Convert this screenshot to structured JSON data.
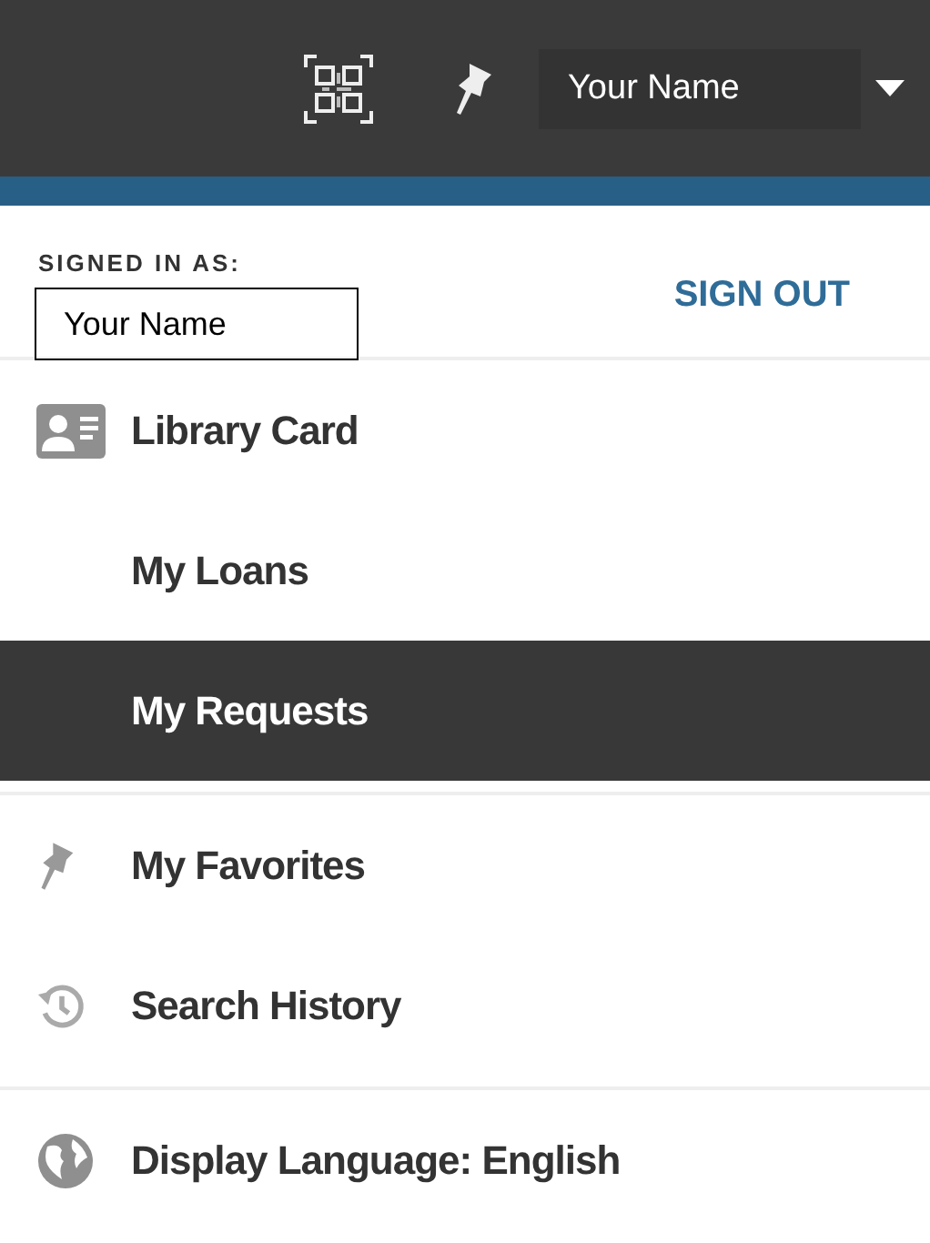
{
  "header": {
    "user_name": "Your Name"
  },
  "account": {
    "label": "SIGNED IN AS:",
    "name": "Your Name",
    "sign_out": "SIGN OUT"
  },
  "menu_groups": [
    {
      "items": [
        {
          "label": "Library Card",
          "kind": "card",
          "selected": false
        },
        {
          "label": "My Loans",
          "kind": "plain",
          "selected": false
        },
        {
          "label": "My Requests",
          "kind": "plain",
          "selected": true
        }
      ]
    },
    {
      "items": [
        {
          "label": "My Favorites",
          "kind": "pin",
          "selected": false
        },
        {
          "label": "Search History",
          "kind": "history",
          "selected": false
        }
      ]
    },
    {
      "items": [
        {
          "label": "Display Language: English",
          "kind": "globe",
          "selected": false
        }
      ]
    }
  ]
}
